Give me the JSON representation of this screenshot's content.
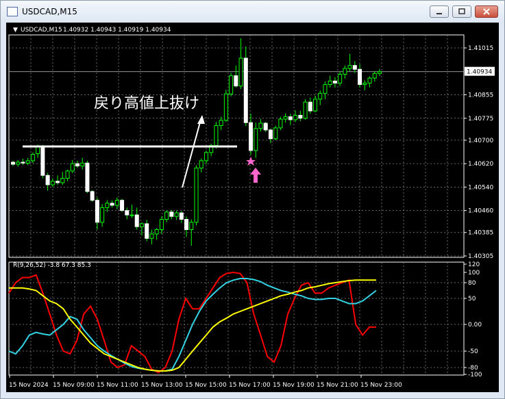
{
  "window": {
    "title": "USDCAD,M15",
    "icon": "chart-window-icon",
    "buttons": [
      "minimize-icon",
      "maximize-icon",
      "close-icon"
    ]
  },
  "chart_data": [
    {
      "type": "candlestick",
      "title": "USDCAD,M15",
      "ohlc_readout": "1.40932 1.40943 1.40919 1.40934",
      "y_ticks": [
        "1.41015",
        "1.40934",
        "1.40855",
        "1.40775",
        "1.40700",
        "1.40620",
        "1.40540",
        "1.40460",
        "1.40385",
        "1.40305"
      ],
      "current_price": "1.40934",
      "ylim": [
        1.40305,
        1.41015
      ],
      "grid": true,
      "x_ticks": [
        "15 Nov 2024",
        "15 Nov 09:00",
        "15 Nov 11:00",
        "15 Nov 13:00",
        "15 Nov 15:00",
        "15 Nov 17:00",
        "15 Nov 19:00",
        "15 Nov 21:00",
        "15 Nov 23:00"
      ],
      "candles": [
        {
          "o": 1.40625,
          "h": 1.4063,
          "l": 1.40612,
          "c": 1.40618
        },
        {
          "o": 1.40618,
          "h": 1.40632,
          "l": 1.4061,
          "c": 1.40625
        },
        {
          "o": 1.40625,
          "h": 1.40637,
          "l": 1.40616,
          "c": 1.40622
        },
        {
          "o": 1.40622,
          "h": 1.4064,
          "l": 1.40615,
          "c": 1.4063
        },
        {
          "o": 1.4063,
          "h": 1.40658,
          "l": 1.40622,
          "c": 1.40652
        },
        {
          "o": 1.40654,
          "h": 1.40685,
          "l": 1.4064,
          "c": 1.4068
        },
        {
          "o": 1.4068,
          "h": 1.40684,
          "l": 1.4057,
          "c": 1.4058
        },
        {
          "o": 1.4058,
          "h": 1.40588,
          "l": 1.40528,
          "c": 1.40548
        },
        {
          "o": 1.40548,
          "h": 1.4057,
          "l": 1.4054,
          "c": 1.4056
        },
        {
          "o": 1.4056,
          "h": 1.4058,
          "l": 1.40548,
          "c": 1.40555
        },
        {
          "o": 1.40555,
          "h": 1.40592,
          "l": 1.40548,
          "c": 1.4057
        },
        {
          "o": 1.4057,
          "h": 1.406,
          "l": 1.4056,
          "c": 1.40595
        },
        {
          "o": 1.40595,
          "h": 1.40632,
          "l": 1.40588,
          "c": 1.4062
        },
        {
          "o": 1.4062,
          "h": 1.4063,
          "l": 1.40605,
          "c": 1.40612
        },
        {
          "o": 1.40612,
          "h": 1.4064,
          "l": 1.406,
          "c": 1.40622
        },
        {
          "o": 1.40622,
          "h": 1.4063,
          "l": 1.4052,
          "c": 1.40525
        },
        {
          "o": 1.40525,
          "h": 1.4053,
          "l": 1.4049,
          "c": 1.40495
        },
        {
          "o": 1.40495,
          "h": 1.40505,
          "l": 1.40395,
          "c": 1.4042
        },
        {
          "o": 1.4042,
          "h": 1.40482,
          "l": 1.40405,
          "c": 1.4047
        },
        {
          "o": 1.4047,
          "h": 1.40495,
          "l": 1.40455,
          "c": 1.40485
        },
        {
          "o": 1.40485,
          "h": 1.40495,
          "l": 1.4047,
          "c": 1.40478
        },
        {
          "o": 1.40478,
          "h": 1.40505,
          "l": 1.40465,
          "c": 1.40495
        },
        {
          "o": 1.40495,
          "h": 1.405,
          "l": 1.40455,
          "c": 1.4046
        },
        {
          "o": 1.4046,
          "h": 1.4047,
          "l": 1.4043,
          "c": 1.40445
        },
        {
          "o": 1.40445,
          "h": 1.4048,
          "l": 1.40435,
          "c": 1.40445
        },
        {
          "o": 1.40445,
          "h": 1.4047,
          "l": 1.40395,
          "c": 1.40405
        },
        {
          "o": 1.40405,
          "h": 1.4042,
          "l": 1.40375,
          "c": 1.40415
        },
        {
          "o": 1.40415,
          "h": 1.40428,
          "l": 1.40355,
          "c": 1.40365
        },
        {
          "o": 1.40365,
          "h": 1.40395,
          "l": 1.40345,
          "c": 1.4038
        },
        {
          "o": 1.4038,
          "h": 1.404,
          "l": 1.4036,
          "c": 1.40395
        },
        {
          "o": 1.40395,
          "h": 1.4044,
          "l": 1.4038,
          "c": 1.4043
        },
        {
          "o": 1.4043,
          "h": 1.4046,
          "l": 1.4042,
          "c": 1.40455
        },
        {
          "o": 1.40455,
          "h": 1.40462,
          "l": 1.4043,
          "c": 1.4044
        },
        {
          "o": 1.4044,
          "h": 1.4046,
          "l": 1.40428,
          "c": 1.40452
        },
        {
          "o": 1.40452,
          "h": 1.40458,
          "l": 1.40418,
          "c": 1.4043
        },
        {
          "o": 1.4043,
          "h": 1.4044,
          "l": 1.4037,
          "c": 1.40395
        },
        {
          "o": 1.40395,
          "h": 1.4043,
          "l": 1.4034,
          "c": 1.4042
        },
        {
          "o": 1.4042,
          "h": 1.40615,
          "l": 1.4041,
          "c": 1.40605
        },
        {
          "o": 1.40605,
          "h": 1.40638,
          "l": 1.4059,
          "c": 1.4063
        },
        {
          "o": 1.4063,
          "h": 1.40665,
          "l": 1.40618,
          "c": 1.40658
        },
        {
          "o": 1.40658,
          "h": 1.40688,
          "l": 1.40645,
          "c": 1.40682
        },
        {
          "o": 1.40682,
          "h": 1.40762,
          "l": 1.40672,
          "c": 1.4075
        },
        {
          "o": 1.4075,
          "h": 1.4078,
          "l": 1.40735,
          "c": 1.40768
        },
        {
          "o": 1.40768,
          "h": 1.40872,
          "l": 1.40762,
          "c": 1.40858
        },
        {
          "o": 1.40858,
          "h": 1.4093,
          "l": 1.4085,
          "c": 1.4092
        },
        {
          "o": 1.4092,
          "h": 1.40955,
          "l": 1.4088,
          "c": 1.40885
        },
        {
          "o": 1.40885,
          "h": 1.41048,
          "l": 1.40875,
          "c": 1.4098
        },
        {
          "o": 1.4098,
          "h": 1.4102,
          "l": 1.40748,
          "c": 1.4076
        },
        {
          "o": 1.4076,
          "h": 1.4079,
          "l": 1.4065,
          "c": 1.40665
        },
        {
          "o": 1.40665,
          "h": 1.4076,
          "l": 1.4064,
          "c": 1.4074
        },
        {
          "o": 1.4074,
          "h": 1.40772,
          "l": 1.4073,
          "c": 1.40758
        },
        {
          "o": 1.40758,
          "h": 1.40762,
          "l": 1.40728,
          "c": 1.40735
        },
        {
          "o": 1.40735,
          "h": 1.4074,
          "l": 1.4069,
          "c": 1.40705
        },
        {
          "o": 1.40705,
          "h": 1.4075,
          "l": 1.407,
          "c": 1.40742
        },
        {
          "o": 1.40742,
          "h": 1.4078,
          "l": 1.40735,
          "c": 1.40772
        },
        {
          "o": 1.40772,
          "h": 1.40792,
          "l": 1.4076,
          "c": 1.4078
        },
        {
          "o": 1.4078,
          "h": 1.4079,
          "l": 1.40752,
          "c": 1.4077
        },
        {
          "o": 1.4077,
          "h": 1.40802,
          "l": 1.40762,
          "c": 1.40785
        },
        {
          "o": 1.40785,
          "h": 1.408,
          "l": 1.40765,
          "c": 1.40775
        },
        {
          "o": 1.40775,
          "h": 1.4084,
          "l": 1.4077,
          "c": 1.4083
        },
        {
          "o": 1.4083,
          "h": 1.40845,
          "l": 1.4079,
          "c": 1.408
        },
        {
          "o": 1.408,
          "h": 1.40852,
          "l": 1.40795,
          "c": 1.4084
        },
        {
          "o": 1.4084,
          "h": 1.4087,
          "l": 1.4082,
          "c": 1.4086
        },
        {
          "o": 1.4086,
          "h": 1.409,
          "l": 1.4084,
          "c": 1.4089
        },
        {
          "o": 1.4089,
          "h": 1.4092,
          "l": 1.4088,
          "c": 1.40902
        },
        {
          "o": 1.40902,
          "h": 1.40915,
          "l": 1.4088,
          "c": 1.40895
        },
        {
          "o": 1.40895,
          "h": 1.40935,
          "l": 1.40885,
          "c": 1.40925
        },
        {
          "o": 1.40925,
          "h": 1.40955,
          "l": 1.4091,
          "c": 1.40945
        },
        {
          "o": 1.40945,
          "h": 1.40995,
          "l": 1.40935,
          "c": 1.40955
        },
        {
          "o": 1.40955,
          "h": 1.4097,
          "l": 1.4093,
          "c": 1.40942
        },
        {
          "o": 1.40942,
          "h": 1.4096,
          "l": 1.4088,
          "c": 1.4089
        },
        {
          "o": 1.4089,
          "h": 1.40905,
          "l": 1.4087,
          "c": 1.40895
        },
        {
          "o": 1.40895,
          "h": 1.40918,
          "l": 1.4088,
          "c": 1.40912
        },
        {
          "o": 1.40912,
          "h": 1.40935,
          "l": 1.409,
          "c": 1.40928
        },
        {
          "o": 1.40928,
          "h": 1.40943,
          "l": 1.40919,
          "c": 1.40934
        }
      ]
    },
    {
      "type": "line",
      "title": "R(9,26,52) -3.8 67.3 85.3",
      "y_ticks": [
        "120",
        "100",
        "80",
        "50",
        "0.00",
        "-50",
        "-80",
        "-100"
      ],
      "ylim": [
        -100,
        120
      ],
      "grid": true,
      "series": [
        {
          "color": "#ff0000",
          "values": [
            60,
            80,
            90,
            90,
            95,
            60,
            20,
            -20,
            -50,
            -55,
            -30,
            20,
            35,
            10,
            -30,
            -70,
            -80,
            -75,
            -40,
            -50,
            -60,
            -85,
            -95,
            -80,
            -50,
            10,
            50,
            30,
            30,
            50,
            70,
            90,
            98,
            100,
            98,
            80,
            20,
            -20,
            -60,
            -70,
            -40,
            20,
            50,
            75,
            80,
            60,
            60,
            70,
            75,
            80,
            85,
            0,
            -20,
            -5,
            -5
          ]
        },
        {
          "color": "#33d4e6",
          "values": [
            -50,
            -55,
            -40,
            -20,
            -15,
            -18,
            -20,
            -10,
            0,
            15,
            10,
            -10,
            -25,
            -40,
            -50,
            -58,
            -65,
            -72,
            -78,
            -82,
            -85,
            -88,
            -90,
            -90,
            -85,
            -60,
            -30,
            0,
            25,
            45,
            58,
            70,
            80,
            85,
            88,
            88,
            86,
            82,
            75,
            70,
            65,
            62,
            58,
            55,
            50,
            48,
            48,
            50,
            50,
            45,
            40,
            40,
            45,
            55,
            65
          ]
        },
        {
          "color": "#ffff00",
          "values": [
            70,
            70,
            70,
            68,
            65,
            55,
            45,
            40,
            30,
            10,
            -5,
            -20,
            -35,
            -45,
            -55,
            -60,
            -65,
            -70,
            -75,
            -80,
            -85,
            -88,
            -90,
            -90,
            -88,
            -80,
            -65,
            -50,
            -35,
            -20,
            -5,
            5,
            12,
            20,
            25,
            30,
            35,
            40,
            45,
            50,
            55,
            58,
            62,
            65,
            70,
            72,
            75,
            78,
            80,
            82,
            84,
            85,
            85,
            85,
            85
          ]
        }
      ]
    }
  ],
  "annotations": {
    "label": "戻り高値上抜け",
    "star": "star-marker-icon",
    "arrow": "up-arrow-icon"
  },
  "colors": {
    "background": "#000000",
    "candle": "#ffffff",
    "wick": "#00ff00",
    "grid": "#888888",
    "macd_red": "#ff0000",
    "macd_cyan": "#33d4e6",
    "macd_yellow": "#ffff00",
    "marker": "#ff66cc"
  }
}
